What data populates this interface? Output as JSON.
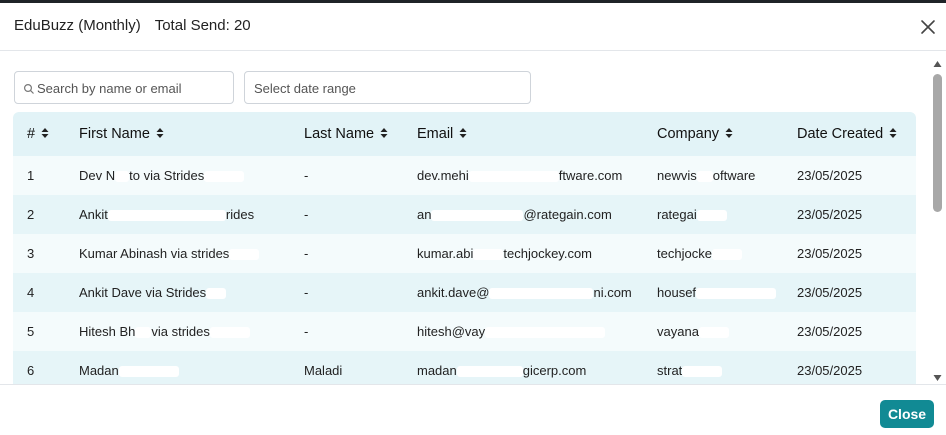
{
  "modal": {
    "title_app": "EduBuzz (Monthly)",
    "title_total": "Total Send: 20"
  },
  "filters": {
    "search_placeholder": "Search by name or email",
    "date_placeholder": "Select date range"
  },
  "table": {
    "columns": [
      "#",
      "First Name",
      "Last Name",
      "Email",
      "Company",
      "Date Created"
    ],
    "rows": [
      {
        "num": "1",
        "first": "Dev N",
        "first_tail": "to via Strides",
        "last": "-",
        "email": "dev.mehi",
        "email_tail": "ftware.com",
        "company": "newvis",
        "company_tail": "oftware",
        "date": "23/05/2025"
      },
      {
        "num": "2",
        "first": "Ankit",
        "first_tail": "rides",
        "last": "-",
        "email": "an",
        "email_tail": "@rategain.com",
        "company": "rategai",
        "company_tail": "",
        "date": "23/05/2025"
      },
      {
        "num": "3",
        "first": "Kumar Abinash via strides",
        "first_tail": "",
        "last": "-",
        "email": "kumar.abi",
        "email_tail": "techjockey.com",
        "company": "techjocke",
        "company_tail": "",
        "date": "23/05/2025"
      },
      {
        "num": "4",
        "first": "Ankit Dave via Strides",
        "first_tail": "",
        "last": "-",
        "email": "ankit.dave@",
        "email_tail": "ni.com",
        "company": "housef",
        "company_tail": "",
        "date": "23/05/2025"
      },
      {
        "num": "5",
        "first": "Hitesh Bh",
        "first_tail": "via strides",
        "last": "-",
        "email": "hitesh@vay",
        "email_tail": "",
        "company": "vayana",
        "company_tail": "",
        "date": "23/05/2025"
      },
      {
        "num": "6",
        "first": "Madan",
        "first_tail": "",
        "last": "Maladi",
        "email": "madan",
        "email_tail": "gicerp.com",
        "company": "strat",
        "company_tail": "",
        "date": "23/05/2025"
      }
    ]
  },
  "footer": {
    "close_label": "Close"
  },
  "colors": {
    "header_bg": "#e2f3f7",
    "row_odd": "#f4fbfc",
    "row_even": "#e6f5f8",
    "close_button": "#118a94"
  },
  "icons": {
    "close": "close-icon",
    "search": "search-icon",
    "sort": "sort-icon",
    "scroll_up": "chevron-up-icon",
    "scroll_down": "chevron-down-icon"
  }
}
